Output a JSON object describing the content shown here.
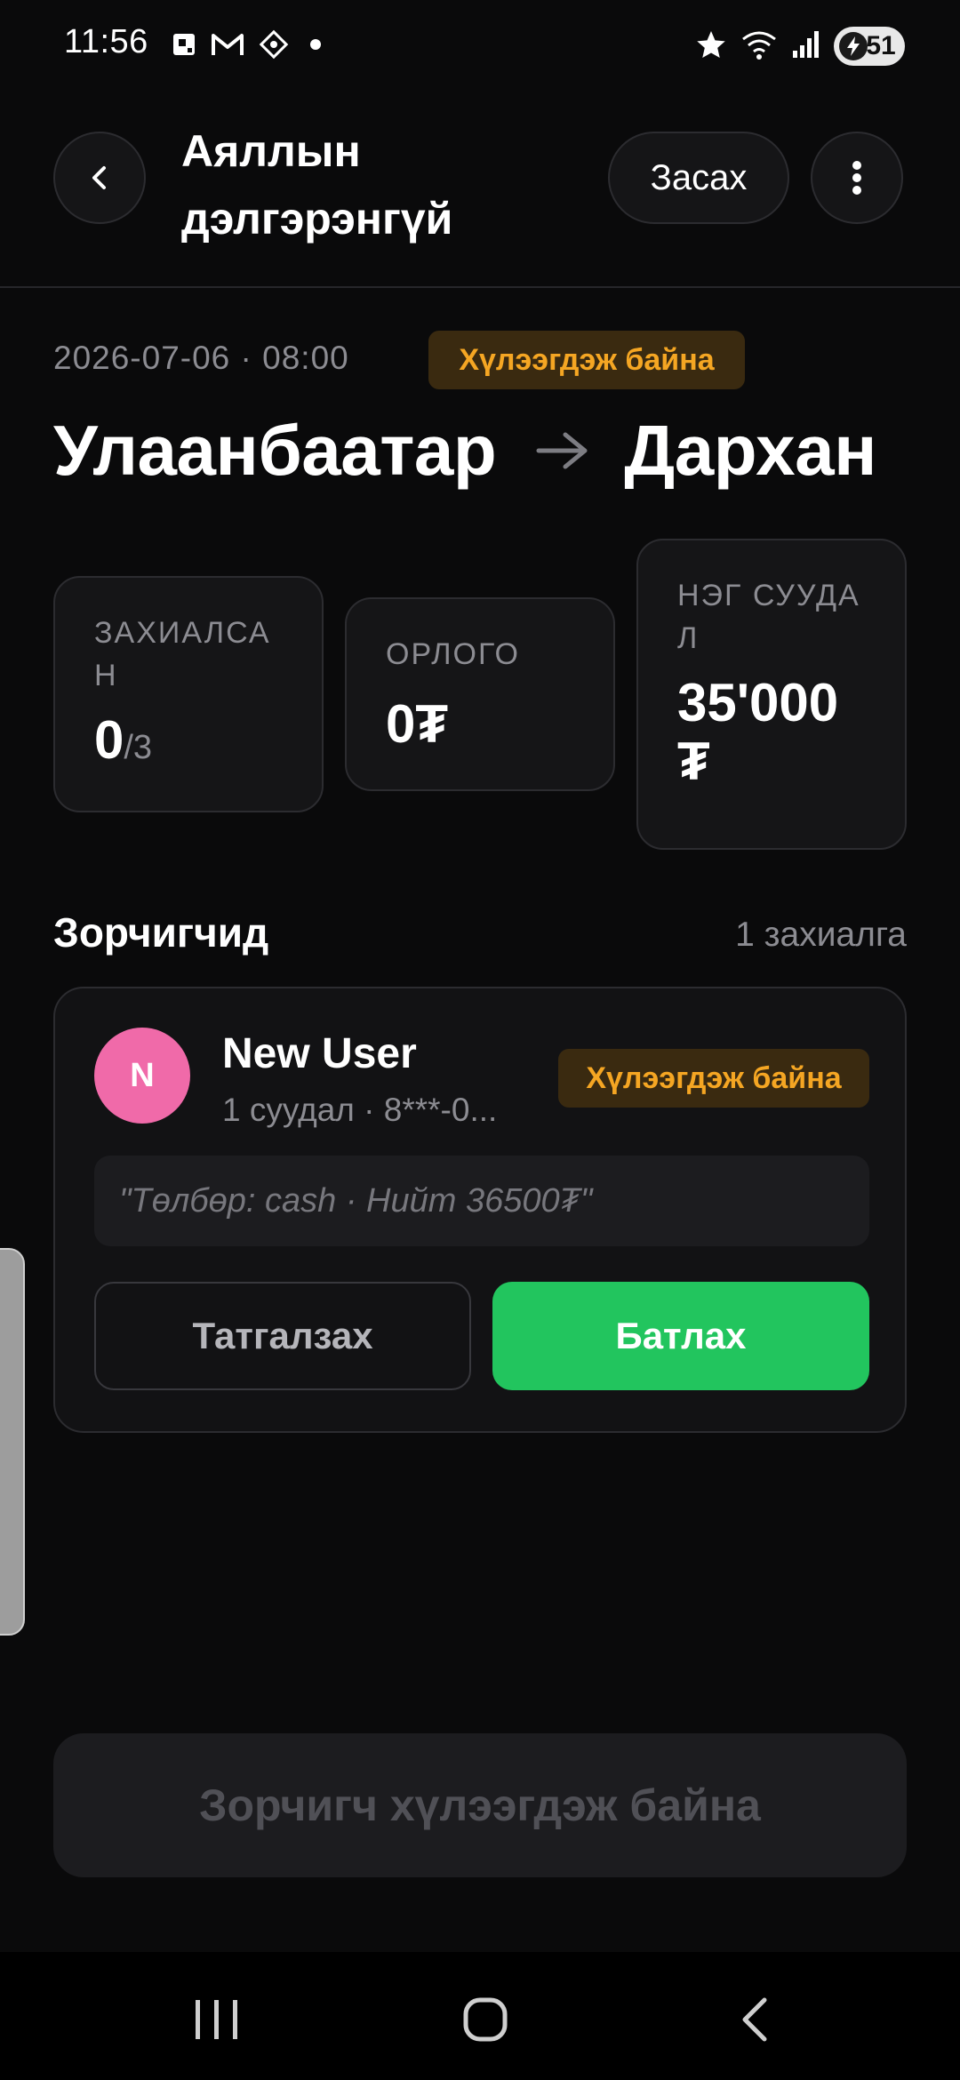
{
  "status_bar": {
    "time": "11:56",
    "battery": "51",
    "left_icons": [
      "notification-app-icon",
      "gmail-icon",
      "app-diamond-icon",
      "dot-icon"
    ],
    "right_icons": [
      "star-icon",
      "wifi-icon",
      "signal-icon",
      "battery-charging-icon"
    ]
  },
  "header": {
    "title": "Аяллын дэлгэрэнгүй",
    "edit_label": "Засах"
  },
  "trip": {
    "datetime": "2026-07-06 · 08:00",
    "status": "Хүлээгдэж байна",
    "from": "Улаанбаатар",
    "to": "Дархан"
  },
  "stats": {
    "booked": {
      "label": "ЗАХИАЛСАН",
      "value": "0",
      "total": "/3"
    },
    "income": {
      "label": "ОРЛОГО",
      "value": "0₮"
    },
    "seat_price": {
      "label": "НЭГ СУУДАЛ",
      "value": "35'000₮"
    }
  },
  "passengers": {
    "title": "Зорчигчид",
    "count": "1 захиалга",
    "items": [
      {
        "initial": "N",
        "name": "New User",
        "meta": "1 суудал · 8***-0...",
        "status": "Хүлээгдэж байна",
        "note": "\"Төлбөр: cash · Нийт 36500₮\"",
        "reject_label": "Татгалзах",
        "approve_label": "Батлах"
      }
    ]
  },
  "bottom_action": {
    "label": "Зорчигч хүлээгдэж байна"
  },
  "colors": {
    "background": "#0a0a0b",
    "card": "#151517",
    "accent_green": "#22c55e",
    "pending_badge_bg": "#3a2a10",
    "pending_badge_text": "#f5a623",
    "avatar": "#f06aa9"
  }
}
